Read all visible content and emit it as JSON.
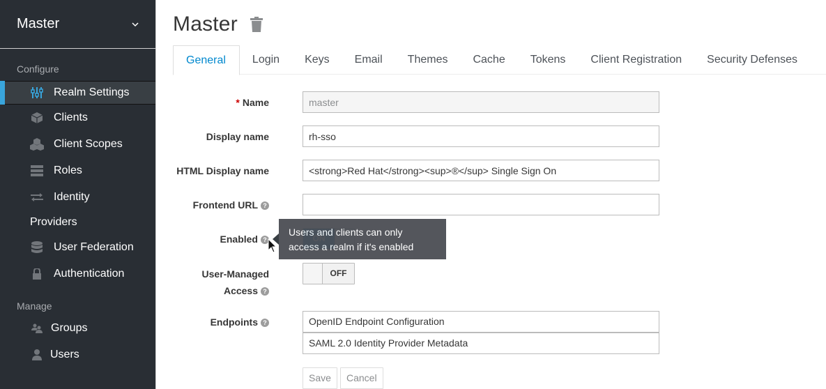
{
  "sidebar": {
    "realm_selector": {
      "label": "Master",
      "icon": "chevron-down-icon"
    },
    "sections": {
      "configure": "Configure",
      "manage": "Manage"
    },
    "configure_items": [
      {
        "label": "Realm Settings",
        "icon": "sliders-icon",
        "active": true
      },
      {
        "label": "Clients",
        "icon": "cube-icon"
      },
      {
        "label": "Client Scopes",
        "icon": "cubes-icon"
      },
      {
        "label": "Roles",
        "icon": "server-icon"
      },
      {
        "label": "Identity",
        "label_line2": "Providers",
        "icon": "exchange-icon"
      },
      {
        "label": "User Federation",
        "icon": "database-icon"
      },
      {
        "label": "Authentication",
        "icon": "lock-icon"
      }
    ],
    "manage_items": [
      {
        "label": "Groups",
        "icon": "users-icon"
      },
      {
        "label": "Users",
        "icon": "user-icon"
      }
    ]
  },
  "header": {
    "title": "Master",
    "delete_icon": "trash-icon"
  },
  "tabs": [
    {
      "label": "General",
      "active": true
    },
    {
      "label": "Login"
    },
    {
      "label": "Keys"
    },
    {
      "label": "Email"
    },
    {
      "label": "Themes"
    },
    {
      "label": "Cache"
    },
    {
      "label": "Tokens"
    },
    {
      "label": "Client Registration"
    },
    {
      "label": "Security Defenses"
    }
  ],
  "form": {
    "name": {
      "label": "Name",
      "required_mark": "*",
      "value": "master"
    },
    "display_name": {
      "label": "Display name",
      "value": "rh-sso"
    },
    "html_display_name": {
      "label": "HTML Display name",
      "value": "<strong>Red Hat</strong><sup>®</sup> Single Sign On"
    },
    "frontend_url": {
      "label": "Frontend URL",
      "value": "",
      "help": "?"
    },
    "enabled": {
      "label": "Enabled",
      "state": "ON",
      "help": "?"
    },
    "user_managed_access": {
      "label_line1": "User-Managed",
      "label_line2": "Access",
      "state": "OFF",
      "help": "?"
    },
    "endpoints": {
      "label": "Endpoints",
      "help": "?",
      "links": [
        "OpenID Endpoint Configuration",
        "SAML 2.0 Identity Provider Metadata"
      ]
    },
    "buttons": {
      "save": "Save",
      "cancel": "Cancel"
    }
  },
  "tooltip": {
    "line1": "Users and clients can only",
    "line2": "access a realm if it's enabled"
  },
  "colors": {
    "sidebar_bg": "#292e34",
    "accent": "#39a5dc",
    "link_active": "#0088ce",
    "tooltip_bg": "#4b4e54"
  }
}
